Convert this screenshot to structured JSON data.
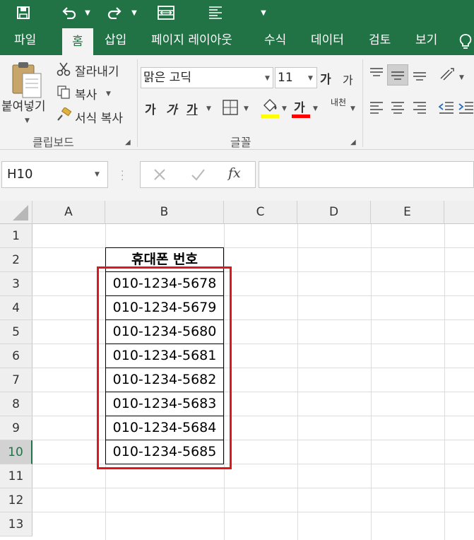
{
  "tabs": [
    "파일",
    "홈",
    "삽입",
    "페이지 레이아웃",
    "수식",
    "데이터",
    "검토",
    "보기"
  ],
  "active_tab": "홈",
  "clipboard": {
    "paste_label": "붙여넣기",
    "cut_label": "잘라내기",
    "copy_label": "복사",
    "format_painter_label": "서식 복사",
    "group_label": "클립보드"
  },
  "font": {
    "font_name": "맑은 고딕",
    "font_size": "11",
    "grow_label": "가",
    "shrink_label": "가",
    "bold_label": "가",
    "italic_label": "가",
    "underline_label": "가",
    "font_color_label": "가",
    "phonetic_label": "내천",
    "group_label": "글꼴",
    "fill_color": "#ffff00",
    "font_color": "#ff0000"
  },
  "name_box": "H10",
  "fx_label": "fx",
  "columns": [
    "A",
    "B",
    "C",
    "D",
    "E"
  ],
  "rows": [
    "1",
    "2",
    "3",
    "4",
    "5",
    "6",
    "7",
    "8",
    "9",
    "10",
    "11",
    "12",
    "13"
  ],
  "selected_row": "10",
  "table": {
    "header": "휴대폰 번호",
    "values": [
      "010-1234-5678",
      "010-1234-5679",
      "010-1234-5680",
      "010-1234-5681",
      "010-1234-5682",
      "010-1234-5683",
      "010-1234-5684",
      "010-1234-5685"
    ]
  },
  "colors": {
    "excel_green": "#217346",
    "highlight_red": "#e0161b"
  }
}
